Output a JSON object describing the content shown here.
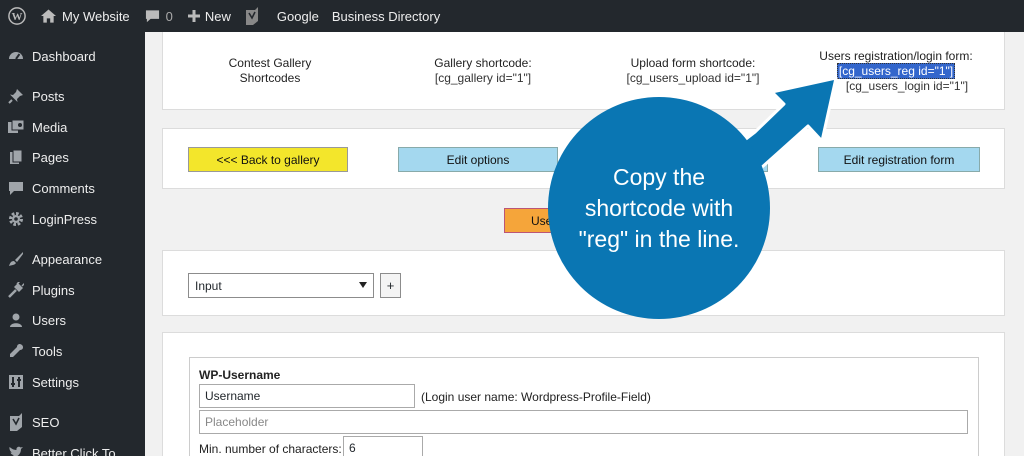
{
  "adminbar": {
    "site_name": "My Website",
    "comments_count": "0",
    "new_label": "New",
    "google_label": "Google",
    "directory_label": "Business Directory"
  },
  "sidebar": {
    "items": [
      {
        "label": "Dashboard",
        "icon": "dashboard-icon"
      },
      {
        "label": "Posts",
        "icon": "pin-icon"
      },
      {
        "label": "Media",
        "icon": "media-icon"
      },
      {
        "label": "Pages",
        "icon": "pages-icon"
      },
      {
        "label": "Comments",
        "icon": "comment-icon"
      },
      {
        "label": "LoginPress",
        "icon": "gear-icon"
      },
      {
        "label": "Appearance",
        "icon": "brush-icon"
      },
      {
        "label": "Plugins",
        "icon": "plugin-icon"
      },
      {
        "label": "Users",
        "icon": "user-icon"
      },
      {
        "label": "Tools",
        "icon": "wrench-icon"
      },
      {
        "label": "Settings",
        "icon": "settings-icon"
      },
      {
        "label": "SEO",
        "icon": "yoast-icon"
      },
      {
        "label": "Better Click To",
        "icon": "twitter-icon"
      }
    ]
  },
  "shortcodes": {
    "contest_title_1": "Contest Gallery",
    "contest_title_2": "Shortcodes",
    "gallery_title": "Gallery shortcode:",
    "gallery_code": "[cg_gallery id=\"1\"]",
    "upload_title": "Upload form shortcode:",
    "upload_code": "[cg_users_upload id=\"1\"]",
    "users_title": "Users registration/login form:",
    "users_reg_code": "[cg_users_reg id=\"1\"]",
    "users_login_code": "[cg_users_login id=\"1\"]"
  },
  "buttons": {
    "back": "<<<   Back to gallery",
    "edit_options": "Edit options",
    "edit_registration": "Edit registration form",
    "user_partial": "Use"
  },
  "form": {
    "select_value": "Input",
    "plus_label": "+",
    "field_heading": "WP-Username",
    "username_value": "Username",
    "username_note": "(Login user name: Wordpress-Profile-Field)",
    "placeholder_text": "Placeholder",
    "min_chars_label": "Min. number of characters:",
    "min_chars_value": "6"
  },
  "callout": {
    "text": "Copy the shortcode with \"reg\" in the line."
  },
  "colors": {
    "adminbar": "#23282d",
    "callout": "#0a76b3",
    "highlight": "#3366cc"
  }
}
